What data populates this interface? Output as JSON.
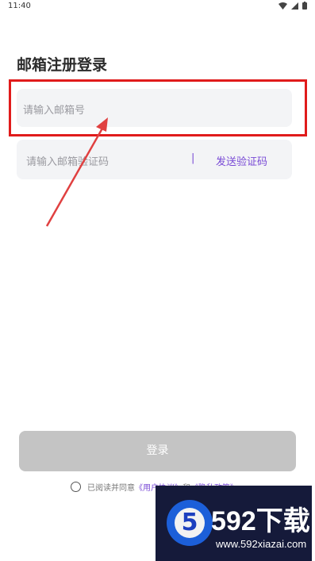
{
  "status_bar": {
    "time": "11:40"
  },
  "page": {
    "title": "邮箱注册登录"
  },
  "email_field": {
    "placeholder": "请输入邮箱号"
  },
  "code_field": {
    "placeholder": "请输入邮箱验证码",
    "separator": "|",
    "send_label": "发送验证码"
  },
  "login_button": {
    "label": "登录"
  },
  "agreement": {
    "prefix": "已阅读并同意",
    "user_agreement": "《用户协议》",
    "conjunction": "和",
    "privacy_policy": "《隐私政策》"
  },
  "watermark": {
    "logo_digit": "5",
    "brand": "592下载",
    "url": "www.592xiazai.com"
  },
  "colors": {
    "accent": "#7a4bd6",
    "highlight": "#e01b1b",
    "button_disabled": "#c4c4c4",
    "field_bg": "#f3f4f6"
  },
  "icons": [
    "wifi-icon",
    "signal-icon",
    "battery-icon",
    "radio-unchecked-icon",
    "arrow-annotation-icon"
  ]
}
